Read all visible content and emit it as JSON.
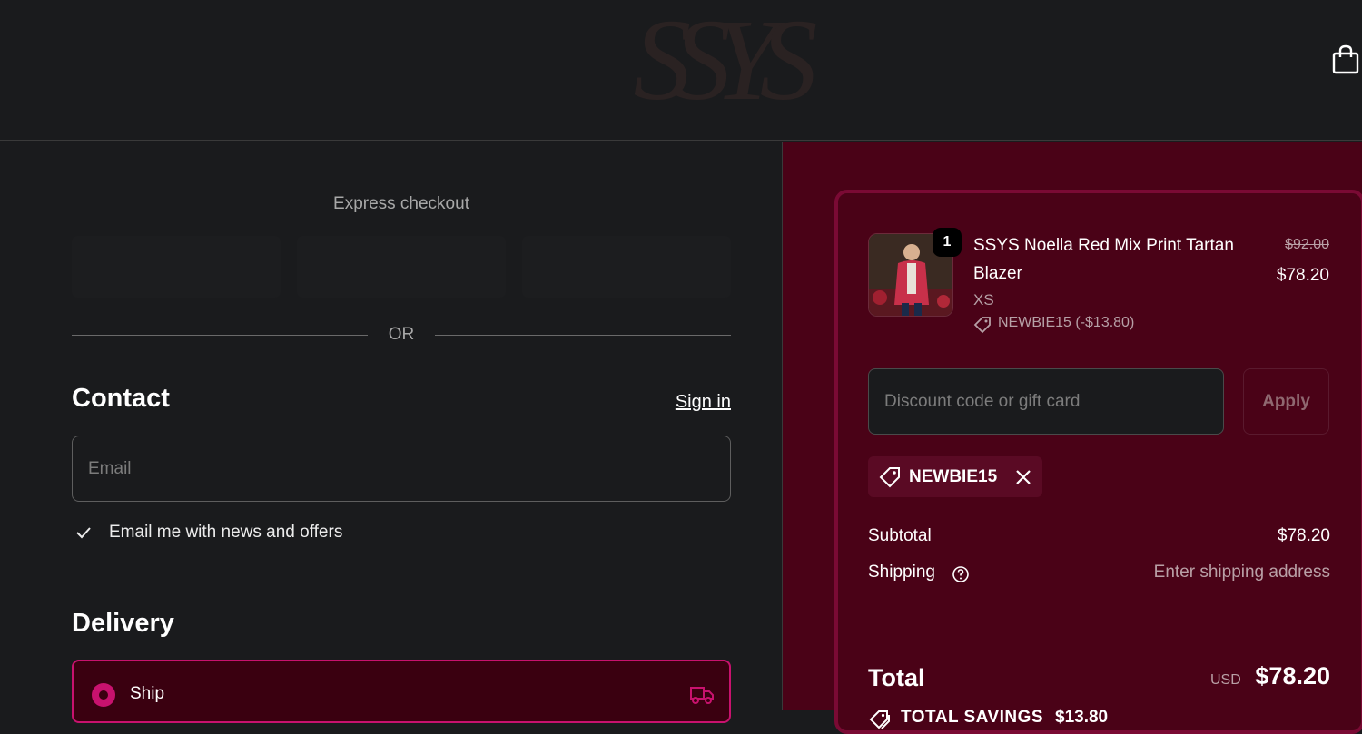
{
  "header": {
    "logo_text": "SSYS",
    "cart_icon": "shopping-bag-icon"
  },
  "express": {
    "title": "Express checkout",
    "or_label": "OR"
  },
  "contact": {
    "title": "Contact",
    "sign_in": "Sign in",
    "email_placeholder": "Email",
    "newsletter_label": "Email me with news and offers",
    "newsletter_checked": true
  },
  "delivery": {
    "title": "Delivery",
    "option_label": "Ship",
    "option_selected": true,
    "option_icon": "truck-icon"
  },
  "summary": {
    "product": {
      "name": "SSYS Noella Red Mix Print Tartan Blazer",
      "quantity": "1",
      "original_price": "$92.00",
      "price": "$78.20",
      "variant": "XS",
      "discount": "NEWBIE15 (-$13.80)"
    },
    "discount_placeholder": "Discount code or gift card",
    "apply_label": "Apply",
    "applied_code": "NEWBIE15",
    "subtotal_label": "Subtotal",
    "subtotal_value": "$78.20",
    "shipping_label": "Shipping",
    "shipping_value": "Enter shipping address",
    "total_label": "Total",
    "total_currency": "USD",
    "total_value": "$78.20",
    "savings_label": "TOTAL SAVINGS",
    "savings_value": "$13.80"
  },
  "colors": {
    "accent": "#c8126e",
    "summary_background": "#4a0217",
    "page_background": "#1a1b1d"
  }
}
